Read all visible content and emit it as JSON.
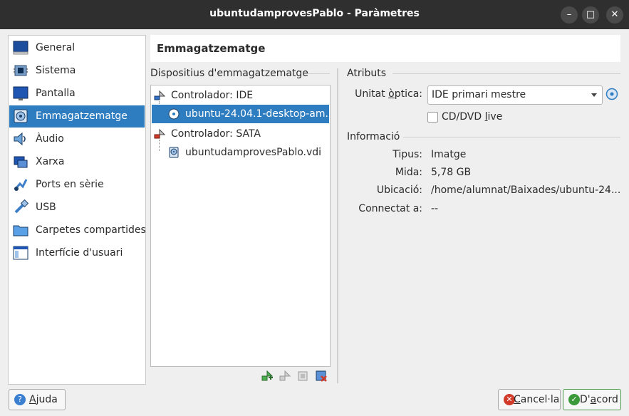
{
  "window": {
    "title": "ubuntudamprovesPablo - Paràmetres",
    "minimize_glyph": "–",
    "maximize_glyph": "□",
    "close_glyph": "✕"
  },
  "sidebar": {
    "items": [
      {
        "label": "General",
        "icon": "general-icon"
      },
      {
        "label": "Sistema",
        "icon": "chip-icon"
      },
      {
        "label": "Pantalla",
        "icon": "monitor-icon"
      },
      {
        "label": "Emmagatzematge",
        "icon": "disk-icon",
        "active": true
      },
      {
        "label": "Àudio",
        "icon": "speaker-icon"
      },
      {
        "label": "Xarxa",
        "icon": "network-icon"
      },
      {
        "label": "Ports en sèrie",
        "icon": "serial-port-icon"
      },
      {
        "label": "USB",
        "icon": "usb-icon"
      },
      {
        "label": "Carpetes compartides",
        "icon": "folder-icon"
      },
      {
        "label": "Interfície d'usuari",
        "icon": "ui-icon"
      }
    ]
  },
  "header": {
    "title": "Emmagatzematge"
  },
  "storage": {
    "section_title": "Dispositius d'emmagatzematge",
    "tree": [
      {
        "label": "Controlador: IDE",
        "type": "controller"
      },
      {
        "label": "ubuntu-24.04.1-desktop-am...",
        "type": "optical",
        "selected": true
      },
      {
        "label": "Controlador: SATA",
        "type": "controller"
      },
      {
        "label": "ubuntudamprovesPablo.vdi",
        "type": "disk"
      }
    ]
  },
  "attributes": {
    "section_title": "Atributs",
    "optical_label_pre": "Unitat ",
    "optical_label_u": "ò",
    "optical_label_post": "ptica:",
    "optical_value": "IDE primari mestre",
    "live_cd_label_pre": "CD/DVD ",
    "live_cd_label_u": "l",
    "live_cd_label_post": "ive",
    "live_cd_checked": false
  },
  "info": {
    "section_title": "Informació",
    "rows": [
      {
        "label": "Tipus:",
        "value": "Imatge"
      },
      {
        "label": "Mida:",
        "value": "5,78 GB"
      },
      {
        "label": "Ubicació:",
        "value": "/home/alumnat/Baixades/ubuntu-24...."
      },
      {
        "label": "Connectat a:",
        "value": "--"
      }
    ]
  },
  "buttons": {
    "help_pre": "",
    "help_u": "A",
    "help_post": "juda",
    "cancel_pre": "",
    "cancel_u": "C",
    "cancel_post": "ancel·la",
    "ok_pre": "D'",
    "ok_u": "a",
    "ok_post": "cord"
  },
  "colors": {
    "accent": "#2f7dc1",
    "titlebar": "#2f2f2f"
  }
}
